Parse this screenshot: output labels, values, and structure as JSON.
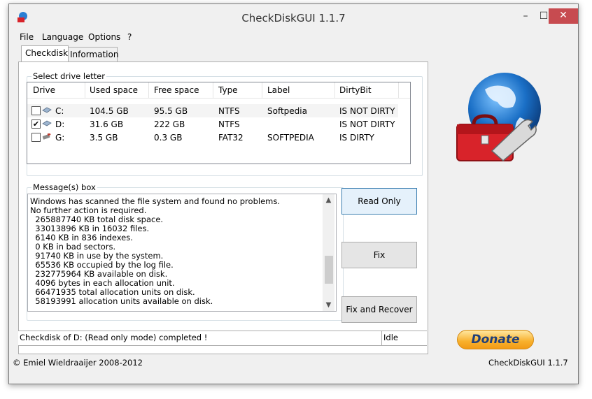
{
  "window": {
    "title": "CheckDiskGUI 1.1.7"
  },
  "menu": [
    "File",
    "Language",
    "Options",
    "?"
  ],
  "tabs": [
    "Checkdisk",
    "Information"
  ],
  "drives_group": {
    "title": "Select drive letter",
    "columns": [
      "Drive",
      "Used space",
      "Free space",
      "Type",
      "Label",
      "DirtyBit"
    ],
    "rows": [
      {
        "checked": false,
        "drive": "C:",
        "used": "104.5 GB",
        "free": "95.5 GB",
        "type": "NTFS",
        "label": "Softpedia",
        "dirty": "IS NOT DIRTY",
        "icon": "hard-drive-icon"
      },
      {
        "checked": true,
        "drive": "D:",
        "used": "31.6 GB",
        "free": "222 GB",
        "type": "NTFS",
        "label": "",
        "dirty": "IS NOT DIRTY",
        "icon": "hard-drive-icon"
      },
      {
        "checked": false,
        "drive": "G:",
        "used": "3.5 GB",
        "free": "0.3 GB",
        "type": "FAT32",
        "label": "SOFTPEDIA",
        "dirty": "IS DIRTY",
        "icon": "usb-drive-icon"
      }
    ]
  },
  "messages": {
    "title": "Message(s) box",
    "lines": [
      "Windows has scanned the file system and found no problems.",
      "No further action is required.",
      "  265887740 KB total disk space.",
      "  33013896 KB in 16032 files.",
      "  6140 KB in 836 indexes.",
      "  0 KB in bad sectors.",
      "  91740 KB in use by the system.",
      "  65536 KB occupied by the log file.",
      "  232775964 KB available on disk.",
      "  4096 bytes in each allocation unit.",
      "  66471935 total allocation units on disk.",
      "  58193991 allocation units available on disk."
    ]
  },
  "buttons": {
    "read_only": "Read Only",
    "fix": "Fix",
    "fix_recover": "Fix and Recover",
    "donate": "Donate"
  },
  "status": {
    "left": "Checkdisk of D: (Read only mode) completed !",
    "right": "Idle"
  },
  "footer": {
    "copyright": "© Emiel Wieldraaijer 2008-2012",
    "version": "CheckDiskGUI 1.1.7"
  },
  "colors": {
    "close_button": "#c74b50",
    "donate_text": "#1f3f7a",
    "globe": "#1a6fc6",
    "toolbox": "#d8232a"
  }
}
